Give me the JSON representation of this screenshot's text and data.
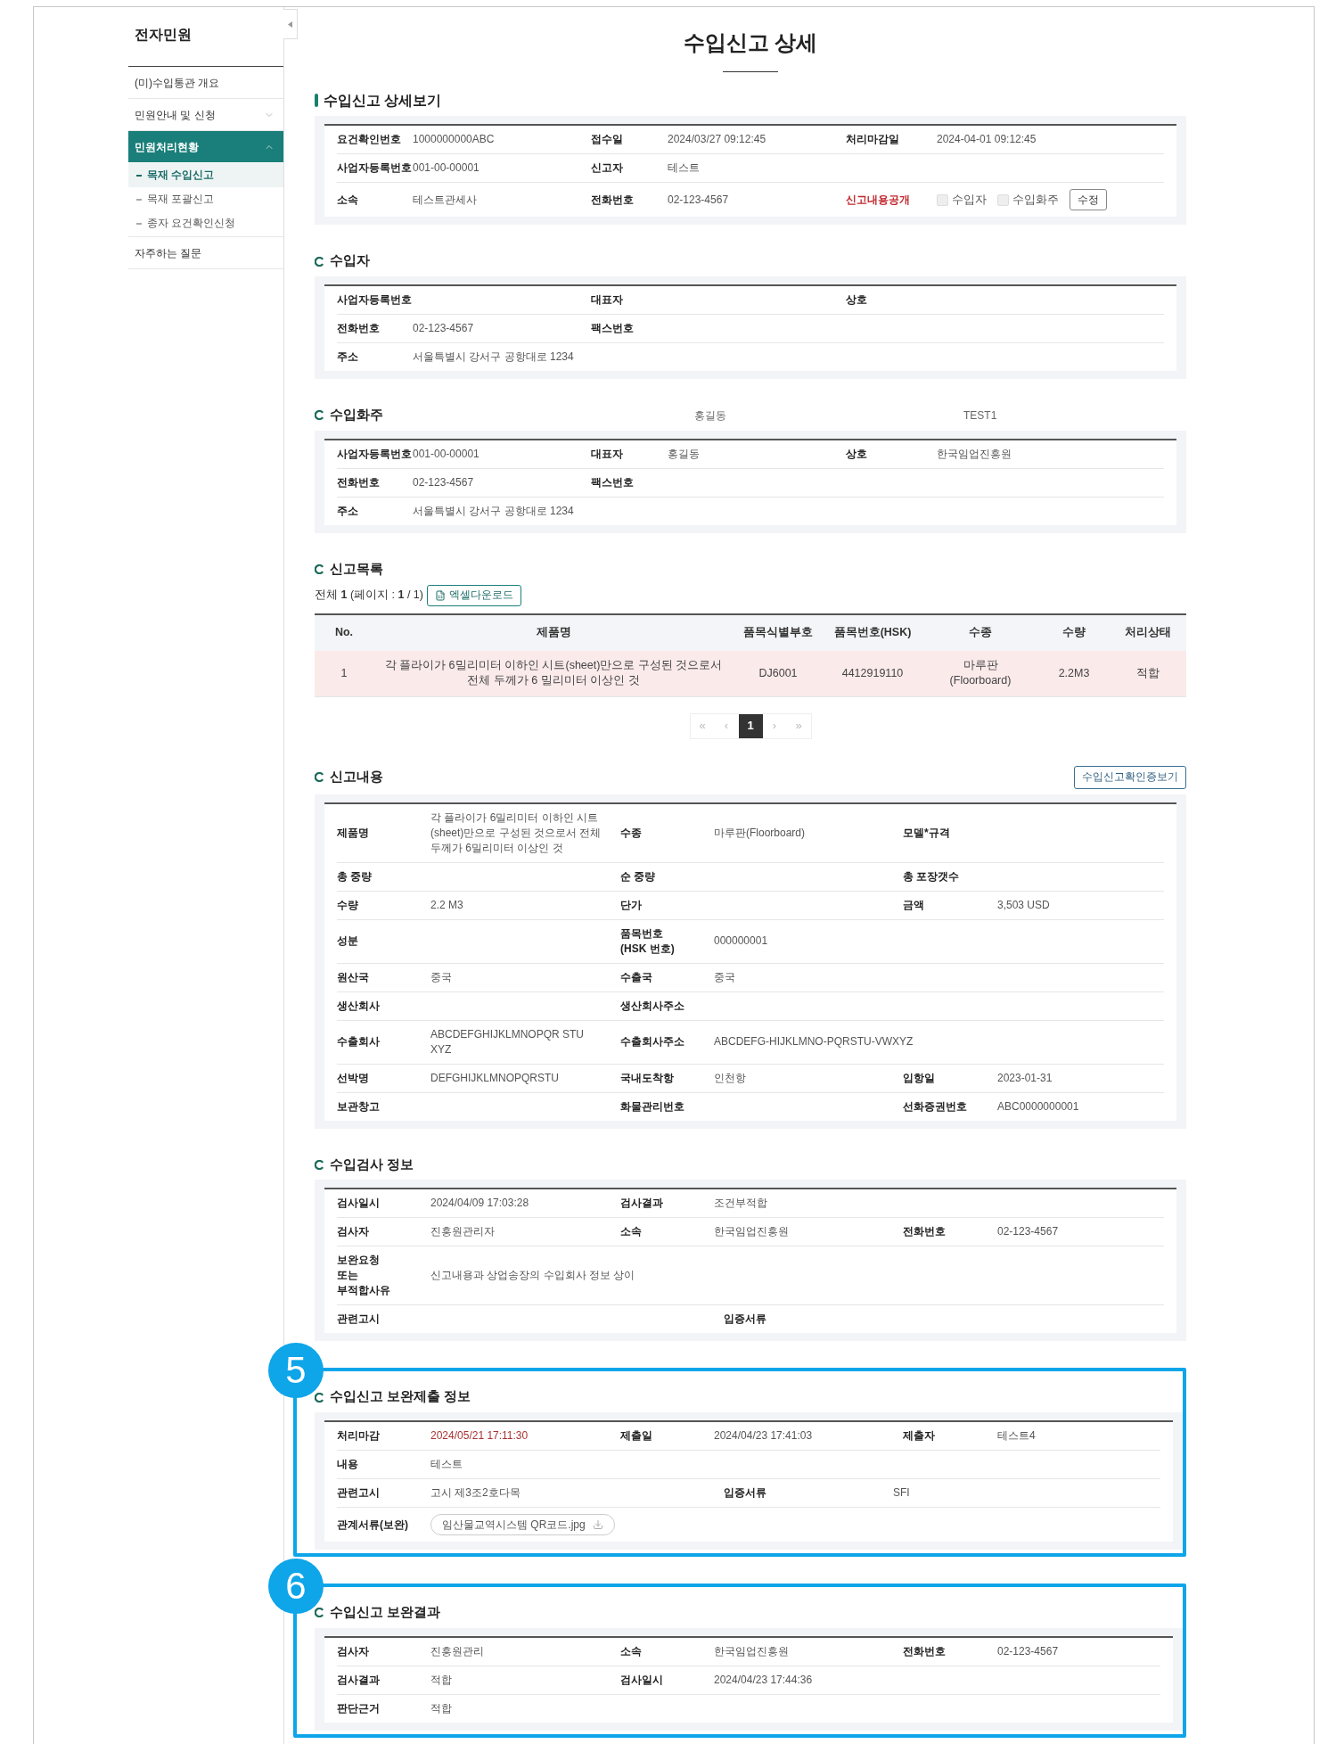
{
  "sidebar": {
    "title": "전자민원",
    "items": [
      {
        "label": "(미)수입통관 개요",
        "selected": false
      },
      {
        "label": "민원안내 및 신청",
        "selected": false,
        "expanded": false
      },
      {
        "label": "민원처리현황",
        "selected": true,
        "expanded": true,
        "children": [
          {
            "label": "목재 수입신고",
            "selected": true
          },
          {
            "label": "목재 포괄신고",
            "selected": false
          },
          {
            "label": "종자 요건확인신청",
            "selected": false
          }
        ]
      },
      {
        "label": "자주하는 질문",
        "selected": false
      }
    ]
  },
  "page_title": "수입신고 상세",
  "sections": [
    {
      "kind": "info",
      "accent_bar": true,
      "wide": false,
      "title": "수입신고 상세보기",
      "rows": [
        {
          "cells": [
            {
              "label": "요건확인번호",
              "value": "1000000000ABC"
            },
            {
              "label": "접수일",
              "value": "2024/03/27 09:12:45"
            },
            {
              "label": "처리마감일",
              "value": "2024-04-01 09:12:45"
            }
          ]
        },
        {
          "cells": [
            {
              "label": "사업자등록번호",
              "value": "001-00-00001"
            },
            {
              "label": "신고자",
              "value": "테스트"
            }
          ]
        },
        {
          "cells": [
            {
              "label": "소속",
              "value": "테스트관세사"
            },
            {
              "label": "전화번호",
              "value": "02-123-4567"
            },
            {
              "label": "신고내용공개",
              "label_alert": true,
              "checkboxes": [
                {
                  "label": "수입자",
                  "checked": false
                },
                {
                  "label": "수입화주",
                  "checked": false
                }
              ],
              "button": "수정"
            }
          ]
        }
      ]
    },
    {
      "kind": "info",
      "accent_bar": false,
      "wide": false,
      "title": "수입자",
      "rows": [
        {
          "cells": [
            {
              "label": "사업자등록번호"
            },
            {
              "label": "대표자"
            },
            {
              "label": "상호"
            }
          ]
        },
        {
          "cells": [
            {
              "label": "전화번호",
              "value": "02-123-4567"
            },
            {
              "label": "팩스번호"
            }
          ]
        },
        {
          "cells": [
            {
              "label": "주소",
              "value": "서울특별시 강서구 공항대로 1234"
            }
          ]
        }
      ]
    },
    {
      "kind": "info",
      "accent_bar": false,
      "wide": false,
      "title": "수입화주",
      "extras": [
        "홍길동",
        "TEST1"
      ],
      "rows": [
        {
          "cells": [
            {
              "label": "사업자등록번호",
              "value": "001-00-00001"
            },
            {
              "label": "대표자",
              "value": "홍길동"
            },
            {
              "label": "상호",
              "value": "한국임업진흥원"
            }
          ]
        },
        {
          "cells": [
            {
              "label": "전화번호",
              "value": "02-123-4567"
            },
            {
              "label": "팩스번호"
            }
          ]
        },
        {
          "cells": [
            {
              "label": "주소",
              "value": "서울특별시 강서구 공항대로 1234"
            }
          ]
        }
      ]
    },
    {
      "kind": "list",
      "accent_bar": false,
      "title": "신고목록",
      "summary": "전체 **1** (페이지 : **1** / 1)",
      "button": "엑셀다운로드",
      "table": {
        "columns": [
          "No.",
          "제품명",
          "품목식별부호",
          "품목번호(HSK)",
          "수종",
          "수량",
          "처리상태"
        ],
        "rows": [
          {
            "selected": true,
            "cells": [
              "1",
              "각 플라이가 6밀리미터 이하인 시트(sheet)만으로 구성된 것으로서 전체 두께가 6 밀리미터 이상인 것",
              "DJ6001",
              "4412919110",
              "마루판(Floorboard)",
              "2.2M3",
              "적합"
            ]
          }
        ]
      },
      "pagination": [
        {
          "label": "«",
          "selected": false
        },
        {
          "label": "‹",
          "selected": false
        },
        {
          "label": "1",
          "selected": true
        },
        {
          "label": "›",
          "selected": false
        },
        {
          "label": "»",
          "selected": false
        }
      ]
    },
    {
      "kind": "info",
      "accent_bar": false,
      "wide": true,
      "title": "신고내용",
      "action": "수입신고확인증보기",
      "rows": [
        {
          "cells": [
            {
              "label": "제품명",
              "value": "각 플라이가 6밀리미터 이하인 시트(sheet)만으로 구성된 것으로서 전체 두께가 6밀리미터 이상인 것",
              "wrap": true
            },
            {
              "label": "수종",
              "value": "마루판(Floorboard)"
            },
            {
              "label": "모델*규격"
            }
          ]
        },
        {
          "cells": [
            {
              "label": "총 중량"
            },
            {
              "label": "순 중량"
            },
            {
              "label": "총 포장갯수"
            }
          ]
        },
        {
          "cells": [
            {
              "label": "수량",
              "value": "2.2 M3"
            },
            {
              "label": "단가"
            },
            {
              "label": "금액",
              "value": "3,503 USD"
            }
          ]
        },
        {
          "cells": [
            {
              "label": "성분"
            },
            {
              "label": "품목번호\n(HSK 번호)",
              "value": "000000001"
            }
          ]
        },
        {
          "cells": [
            {
              "label": "원산국",
              "value": "중국"
            },
            {
              "label": "수출국",
              "value": "중국"
            }
          ]
        },
        {
          "cells": [
            {
              "label": "생산회사"
            },
            {
              "label": "생산회사주소"
            }
          ]
        },
        {
          "cells": [
            {
              "label": "수출회사",
              "value": "ABCDEFGHIJKLMNOPQR STU XYZ",
              "wrap": true
            },
            {
              "label": "수출회사주소",
              "value": "ABCDEFG-HIJKLMNO-PQRSTU-VWXYZ"
            }
          ]
        },
        {
          "cells": [
            {
              "label": "선박명",
              "value": "DEFGHIJKLMNOPQRSTU"
            },
            {
              "label": "국내도착항",
              "value": "인천항"
            },
            {
              "label": "입항일",
              "value": "2023-01-31"
            }
          ]
        },
        {
          "cells": [
            {
              "label": "보관창고"
            },
            {
              "label": "화물관리번호"
            },
            {
              "label": "선화증권번호",
              "value": "ABC0000000001"
            }
          ]
        }
      ]
    },
    {
      "kind": "info",
      "accent_bar": false,
      "wide": true,
      "title": "수입검사 정보",
      "rows": [
        {
          "cells": [
            {
              "label": "검사일시",
              "value": "2024/04/09 17:03:28"
            },
            {
              "label": "검사결과",
              "value": "조건부적합"
            }
          ]
        },
        {
          "cells": [
            {
              "label": "검사자",
              "value": "진흥원관리자"
            },
            {
              "label": "소속",
              "value": "한국임업진흥원"
            },
            {
              "label": "전화번호",
              "value": "02-123-4567"
            }
          ]
        },
        {
          "cells": [
            {
              "label": "보완요청\n또는\n부적합사유",
              "value": "신고내용과 상업송장의 수입회사 정보 상이"
            }
          ]
        },
        {
          "kind": "half",
          "cells": [
            {
              "label": "관련고시"
            },
            {
              "label": "입증서류"
            }
          ]
        }
      ]
    },
    {
      "kind": "info",
      "accent_bar": false,
      "wide": true,
      "title": "수입신고 보완제출 정보",
      "callout": "5",
      "rows": [
        {
          "cells": [
            {
              "label": "처리마감",
              "value": "2024/05/21 17:11:30",
              "value_alert": true
            },
            {
              "label": "제출일",
              "value": "2024/04/23 17:41:03"
            },
            {
              "label": "제출자",
              "value": "테스트4"
            }
          ]
        },
        {
          "cells": [
            {
              "label": "내용",
              "value": "테스트"
            }
          ]
        },
        {
          "kind": "half",
          "cells": [
            {
              "label": "관련고시",
              "value": "고시 제3조2호다목"
            },
            {
              "label": "입증서류",
              "value": "SFI"
            }
          ]
        },
        {
          "cells": [
            {
              "label": "관계서류(보완)",
              "file": "임산물교역시스템 QR코드.jpg"
            }
          ]
        }
      ]
    },
    {
      "kind": "info",
      "accent_bar": false,
      "wide": true,
      "title": "수입신고 보완결과",
      "callout": "6",
      "rows": [
        {
          "cells": [
            {
              "label": "검사자",
              "value": "진흥원관리"
            },
            {
              "label": "소속",
              "value": "한국임업진흥원"
            },
            {
              "label": "전화번호",
              "value": "02-123-4567"
            }
          ]
        },
        {
          "cells": [
            {
              "label": "검사결과",
              "value": "적합"
            },
            {
              "label": "검사일시",
              "value": "2024/04/23 17:44:36"
            }
          ]
        },
        {
          "cells": [
            {
              "label": "판단근거",
              "value": "적합"
            }
          ]
        }
      ]
    }
  ]
}
